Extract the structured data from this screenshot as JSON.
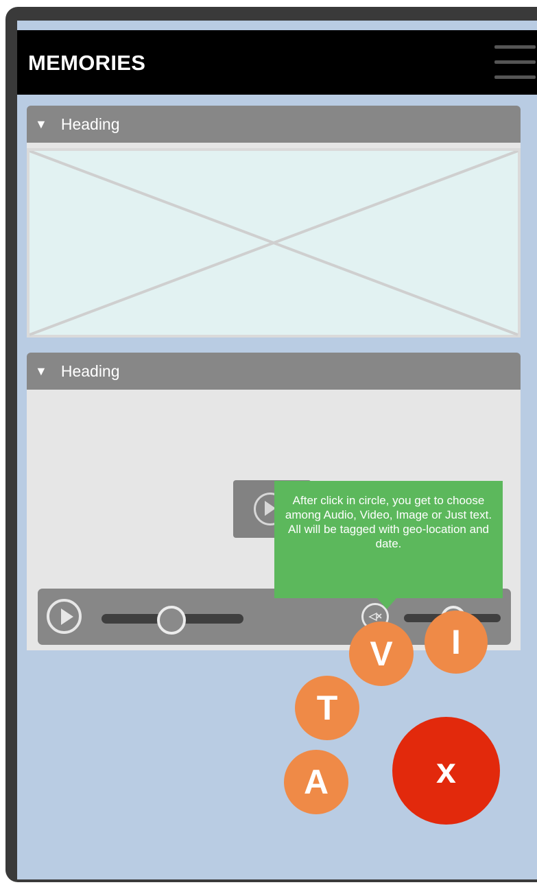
{
  "app": {
    "title": "MEMORIES",
    "menu_icon": "hamburger-menu-icon"
  },
  "panels": [
    {
      "heading": "Heading",
      "caret": "▼",
      "content": "image-placeholder"
    },
    {
      "heading": "Heading",
      "caret": "▼",
      "content": "video-player"
    }
  ],
  "video": {
    "big_play_icon": "play-icon",
    "seek_progress": 0.45,
    "volume_level": 0.48,
    "mute_icon": "mute-icon",
    "mute_glyph": "◁×"
  },
  "tooltip": {
    "text": "After click in circle, you get to choose among Audio, Video, Image or Just text. All will be tagged with geo-location and date."
  },
  "fab": {
    "image_label": "I",
    "video_label": "V",
    "text_label": "T",
    "audio_label": "A",
    "close_label": "x"
  },
  "colors": {
    "background": "#b9cce3",
    "appbar": "#000000",
    "panel_header": "#878787",
    "tooltip": "#5cb85c",
    "fab_option": "#ef8a47",
    "fab_close": "#e2290c"
  }
}
